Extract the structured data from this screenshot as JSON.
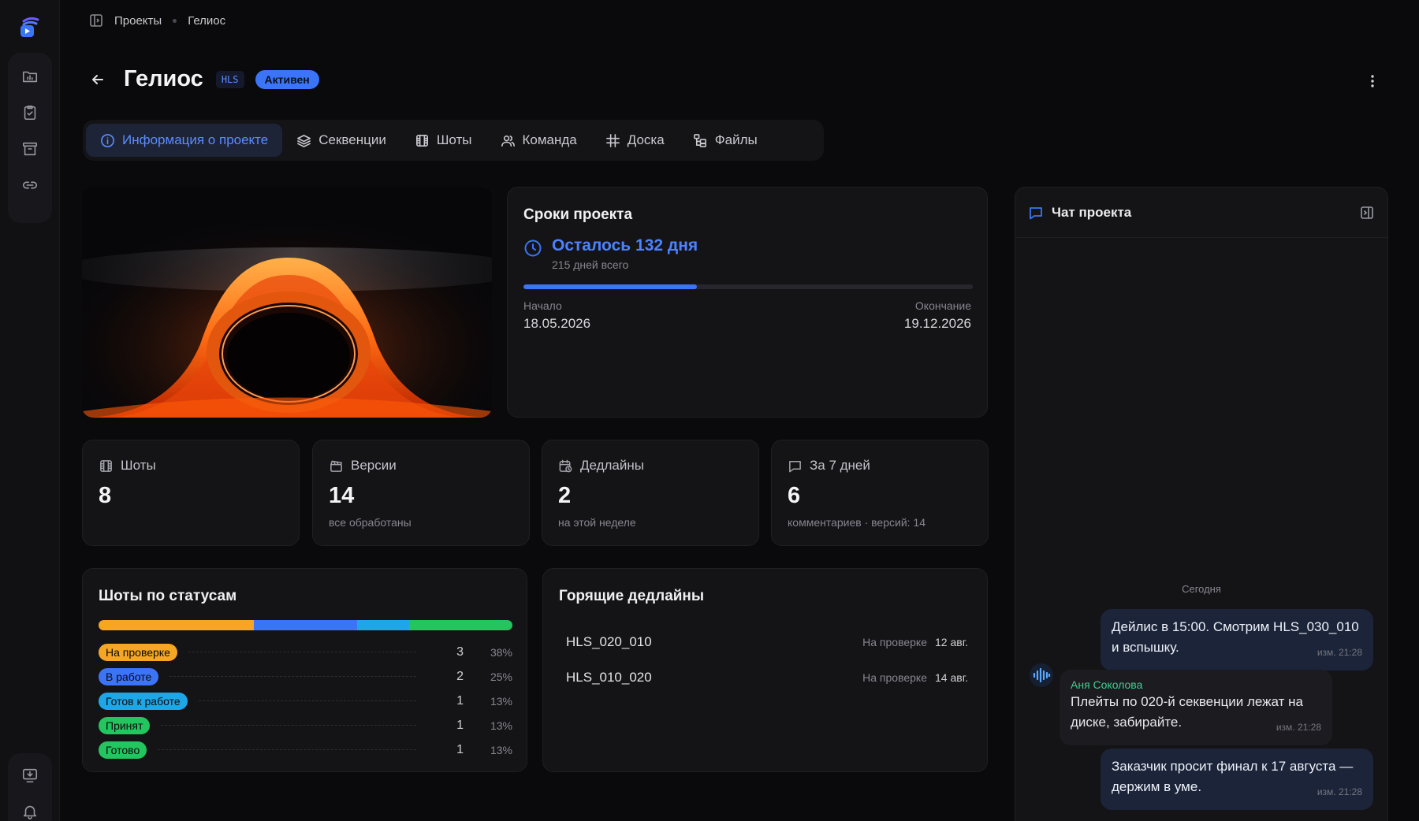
{
  "breadcrumb": {
    "root": "Проекты",
    "current": "Гелиос"
  },
  "project": {
    "title": "Гелиос",
    "code": "HLS",
    "status": "Активен"
  },
  "tabs": [
    {
      "label": "Информация о проекте",
      "icon": "info-icon",
      "active": true
    },
    {
      "label": "Секвенции",
      "icon": "layers-icon",
      "active": false
    },
    {
      "label": "Шоты",
      "icon": "film-icon",
      "active": false
    },
    {
      "label": "Команда",
      "icon": "users-icon",
      "active": false
    },
    {
      "label": "Доска",
      "icon": "hash-icon",
      "active": false
    },
    {
      "label": "Файлы",
      "icon": "folder-tree-icon",
      "active": false
    }
  ],
  "timeline": {
    "title": "Сроки проекта",
    "remaining": "Осталось 132 дня",
    "total": "215 дней всего",
    "progress_fraction": 0.386,
    "start_label": "Начало",
    "start_date": "18.05.2026",
    "end_label": "Окончание",
    "end_date": "19.12.2026"
  },
  "stats": [
    {
      "label": "Шоты",
      "value": "8",
      "sub": "",
      "icon": "film-icon"
    },
    {
      "label": "Версии",
      "value": "14",
      "sub": "все обработаны",
      "icon": "clapper-icon"
    },
    {
      "label": "Дедлайны",
      "value": "2",
      "sub": "на этой неделе",
      "icon": "calendar-clock-icon"
    },
    {
      "label": "За 7 дней",
      "value": "6",
      "sub": "комментариев · версий: 14",
      "icon": "comment-icon"
    }
  ],
  "statuses": {
    "title": "Шоты по статусам",
    "items": [
      {
        "label": "На проверке",
        "count": "3",
        "pct": "38%",
        "color": "#f5a623"
      },
      {
        "label": "В работе",
        "count": "2",
        "pct": "25%",
        "color": "#3b74f6"
      },
      {
        "label": "Готов к работе",
        "count": "1",
        "pct": "13%",
        "color": "#1ea7e8"
      },
      {
        "label": "Принят",
        "count": "1",
        "pct": "13%",
        "color": "#22c55e"
      },
      {
        "label": "Готово",
        "count": "1",
        "pct": "13%",
        "color": "#22c55e"
      }
    ]
  },
  "deadlines": {
    "title": "Горящие дедлайны",
    "items": [
      {
        "shot": "HLS_020_010",
        "status": "На проверке",
        "date": "12 авг."
      },
      {
        "shot": "HLS_010_020",
        "status": "На проверке",
        "date": "14 авг."
      }
    ]
  },
  "chat": {
    "title": "Чат проекта",
    "day": "Сегодня",
    "messages": [
      {
        "dir": "out",
        "text": "Дейлис в 15:00. Смотрим HLS_030_010 и вспышку.",
        "meta": "изм. 21:28"
      },
      {
        "dir": "in",
        "author": "Аня Соколова",
        "text": "Плейты по 020-й секвенции лежат на диске, забирайте.",
        "meta": "изм. 21:28"
      },
      {
        "dir": "out",
        "text": "Заказчик просит финал к 17 августа — держим в уме.",
        "meta": "изм. 21:28"
      }
    ]
  },
  "colors": {
    "accent": "#3b74f6",
    "background": "#0a0a0c",
    "card": "#141417"
  }
}
